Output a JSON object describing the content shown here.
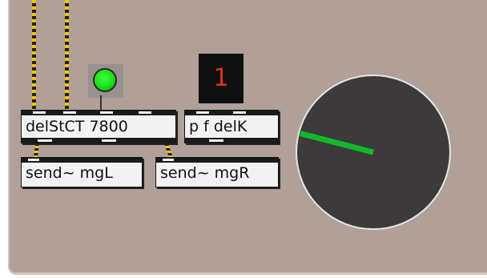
{
  "objects": {
    "delay_label": "delStCT 7800",
    "pfdel_label": "p f delK",
    "send_left_label": "send~ mgL",
    "send_right_label": "send~ mgR"
  },
  "number_box": {
    "value": "1"
  },
  "toggle": {
    "state": "on",
    "color": "#22e022"
  },
  "dial": {
    "value_fraction": 0.22,
    "indicator_color": "#12b82a"
  },
  "colors": {
    "background": "#b0a098",
    "cable_stripe": "#f2c40c",
    "number_text": "#e2311c"
  }
}
